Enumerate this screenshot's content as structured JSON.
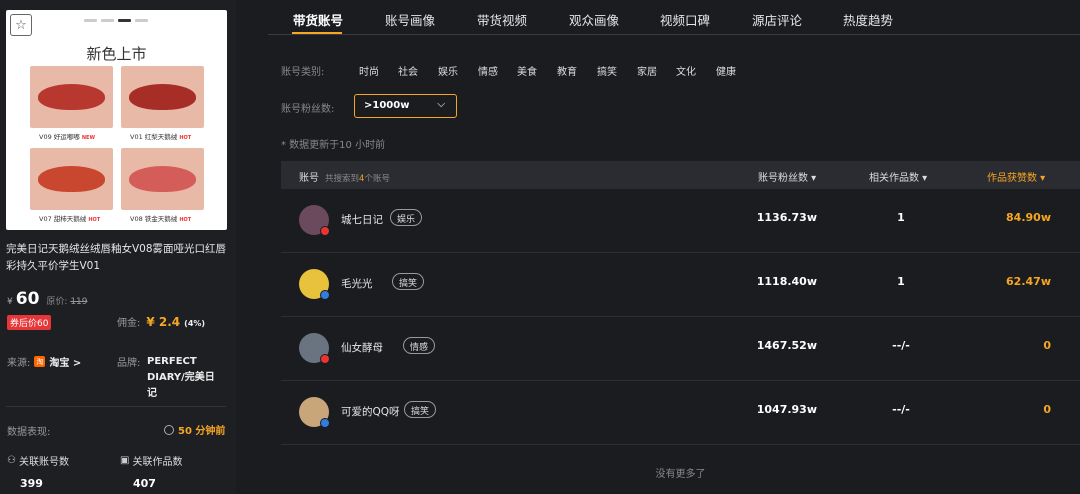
{
  "product": {
    "image_title": "新色上市",
    "swatches": [
      {
        "label": "V09 好运嘟嘟",
        "tag": "NEW",
        "color": "#c4463b",
        "lip": "#b8372f"
      },
      {
        "label": "V01 红梨天鹅绒",
        "tag": "HOT",
        "color": "#b93a33",
        "lip": "#a72e27"
      },
      {
        "label": "V07 甜柿天鹅绒",
        "tag": "HOT",
        "color": "#d6563f",
        "lip": "#c9462f"
      },
      {
        "label": "V08 铁金天鹅绒",
        "tag": "HOT",
        "color": "#de7470",
        "lip": "#d45d59"
      }
    ],
    "title": "完美日记天鹅绒丝绒唇釉女V08雾面哑光口红唇彩持久平价学生V01",
    "currency": "¥",
    "price": "60",
    "orig_label": "原价:",
    "orig_price": "119",
    "coupon": "券后价60",
    "commission_label": "佣金:",
    "commission_value": "¥ 2.4",
    "commission_pct": "(4%)",
    "source_label": "来源:",
    "source_icon": "淘",
    "source_value": "淘宝 >",
    "brand_label": "品牌:",
    "brand_value": "PERFECT DIARY/完美日记",
    "perf_label": "数据表现:",
    "perf_time": "50 分钟前",
    "linked_accounts_label": "关联账号数",
    "linked_accounts_value": "399",
    "linked_works_label": "关联作品数",
    "linked_works_value": "407"
  },
  "tabs": [
    "带货账号",
    "账号画像",
    "带货视频",
    "观众画像",
    "视频口碑",
    "源店评论",
    "热度趋势"
  ],
  "filters": {
    "category_label": "账号类别:",
    "categories": [
      "时尚",
      "社会",
      "娱乐",
      "情感",
      "美食",
      "教育",
      "搞笑",
      "家居",
      "文化",
      "健康"
    ],
    "fans_label": "账号粉丝数:",
    "fans_value": ">1000w",
    "fans_chevron": "⌵",
    "update_note": "* 数据更新于10 小时前"
  },
  "table": {
    "col_account": "账号",
    "col_account_sub_pre": "共搜索到",
    "col_account_sub_count": "4",
    "col_account_sub_post": "个账号",
    "col_fans": "账号粉丝数 ▾",
    "col_works": "相关作品数 ▾",
    "col_likes": "作品获赞数 ▾",
    "rows": [
      {
        "name": "城七日记",
        "tag": "娱乐",
        "fans": "1136.73w",
        "works": "1",
        "likes": "84.90w",
        "avatar_color": "#6b4a5e",
        "badge_color": "#e33"
      },
      {
        "name": "毛光光",
        "tag": "搞笑",
        "fans": "1118.40w",
        "works": "1",
        "likes": "62.47w",
        "avatar_color": "#e8c23a",
        "badge_color": "#2f7de1"
      },
      {
        "name": "仙女酵母",
        "tag": "情感",
        "fans": "1467.52w",
        "works": "--/-",
        "likes": "0",
        "avatar_color": "#6a7480",
        "badge_color": "#e33"
      },
      {
        "name": "可爱的QQ呀",
        "tag": "搞笑",
        "fans": "1047.93w",
        "works": "--/-",
        "likes": "0",
        "avatar_color": "#c9a67a",
        "badge_color": "#2f7de1"
      }
    ],
    "no_more": "没有更多了"
  }
}
